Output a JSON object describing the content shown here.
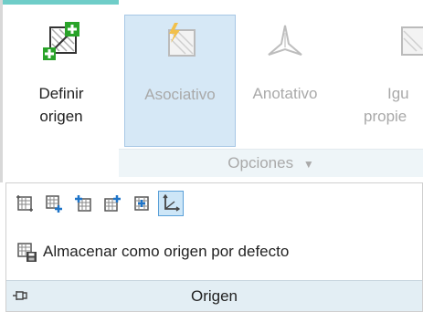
{
  "ribbon": {
    "definir": {
      "label_line1": "Definir",
      "label_line2": "origen"
    },
    "asociativo": {
      "label": "Asociativo"
    },
    "anotativo": {
      "label": "Anotativo"
    },
    "igual": {
      "label_line1": "Igu",
      "label_line2": "propie"
    },
    "options": {
      "label": "Opciones"
    }
  },
  "flyout": {
    "store_default": {
      "label": "Almacenar como origen por defecto"
    },
    "panel_title": "Origen"
  },
  "colors": {
    "accent": "#6fcdc8",
    "green": "#29a329",
    "blue": "#1e74c8",
    "active_bg": "#cde6f7"
  }
}
